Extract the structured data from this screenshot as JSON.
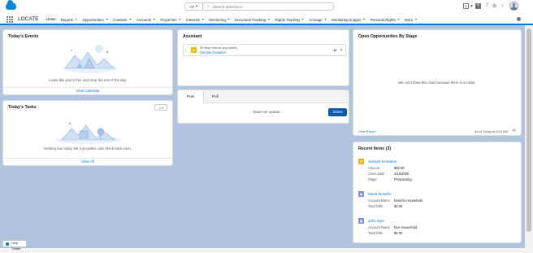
{
  "header": {
    "search_scope": "All",
    "search_placeholder": "Search Salesforce"
  },
  "nav": {
    "app_name": "LOCATE",
    "tabs": [
      {
        "label": "Home"
      },
      {
        "label": "Reports"
      },
      {
        "label": "Opportunities"
      },
      {
        "label": "Contacts"
      },
      {
        "label": "Accounts"
      },
      {
        "label": "Properties"
      },
      {
        "label": "Interests"
      },
      {
        "label": "Monitoring"
      },
      {
        "label": "Document Tracking"
      },
      {
        "label": "Rights Tracking"
      },
      {
        "label": "Acreage"
      },
      {
        "label": "Monitoring Images"
      },
      {
        "label": "Personal Rights"
      },
      {
        "label": "More"
      }
    ]
  },
  "events": {
    "title": "Today's Events",
    "empty": "Looks like you're free and clear the rest of the day.",
    "footer": "View Calendar"
  },
  "tasks": {
    "title": "Today's Tasks",
    "empty": "Nothing due today. Be a go-getter, and check back soon.",
    "footer": "View All"
  },
  "assistant": {
    "title": "Assistant",
    "item_note": "90 days without any activity",
    "item_link": "Sample Donation"
  },
  "publisher": {
    "tab_post": "Post",
    "tab_poll": "Poll",
    "placeholder": "Share an update...",
    "share_label": "Share"
  },
  "opportunities": {
    "title": "Open Opportunities By Stage",
    "empty": "We can't draw this chart because there is no data.",
    "view_report": "View Report",
    "as_of": "As of Today at 8:10 AM"
  },
  "recent": {
    "title": "Recent Items (3)",
    "items": [
      {
        "name": "Sample Donation",
        "icon_color": "#f4b400",
        "fields": [
          {
            "label": "Amount",
            "value": "$25.00"
          },
          {
            "label": "Close Date",
            "value": "1/10/2000"
          },
          {
            "label": "Stage",
            "value": "Prospecting"
          }
        ]
      },
      {
        "name": "Maria Noseño",
        "icon_color": "#7f8de1",
        "fields": [
          {
            "label": "Account Name",
            "value": "Noseño Household"
          },
          {
            "label": "Total Gifts",
            "value": "$0.00"
          }
        ]
      },
      {
        "name": "John Doe",
        "icon_color": "#7f8de1",
        "fields": [
          {
            "label": "Account Name",
            "value": "Doe Household"
          },
          {
            "label": "Total Gifts",
            "value": "$0.00"
          }
        ]
      }
    ]
  },
  "utility": {
    "label": "Help Center"
  }
}
